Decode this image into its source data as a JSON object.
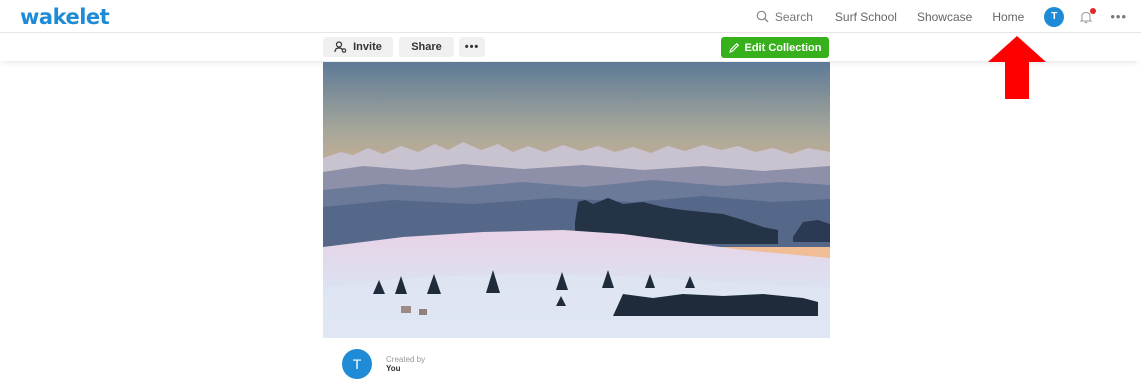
{
  "brand": {
    "logo_text": "wakelet",
    "color": "#1f8bd6"
  },
  "nav": {
    "search_label": "Search",
    "links": [
      "Surf School",
      "Showcase",
      "Home"
    ],
    "avatar_initial": "T",
    "notification_color": "#e3262c",
    "more_label": "•••"
  },
  "toolbar": {
    "invite_label": "Invite",
    "share_label": "Share",
    "more_label": "•••",
    "edit_label": "Edit Collection",
    "edit_color": "#37b11b"
  },
  "hero": {
    "description_icon": "winter-landscape-image"
  },
  "creator": {
    "avatar_initial": "T",
    "label": "Created by",
    "name": "You"
  },
  "annotation": {
    "arrow_color": "#ff0000",
    "points_to": "Home"
  }
}
